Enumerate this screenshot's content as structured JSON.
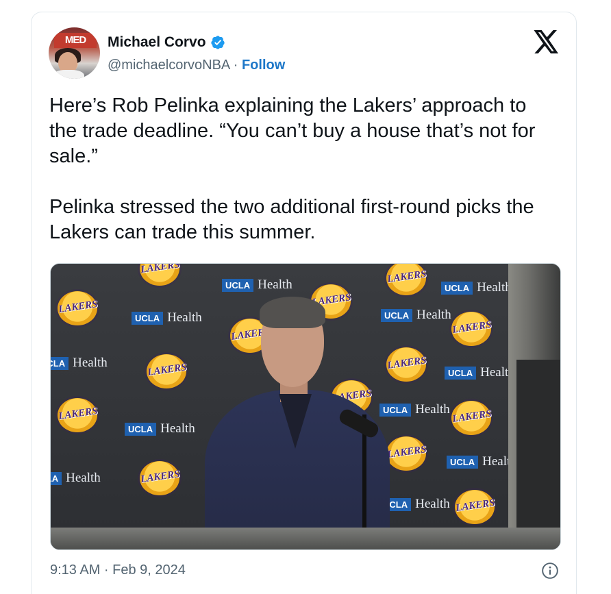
{
  "author": {
    "display_name": "Michael Corvo",
    "handle": "@michaelcorvoNBA",
    "separator": "·",
    "follow_label": "Follow",
    "avatar_sign_text": "MED"
  },
  "tweet": {
    "paragraphs": [
      "Here’s Rob Pelinka explaining the Lakers’ approach to the trade deadline. “You can’t buy a house that’s not for sale.”",
      "Pelinka stressed the two additional first-round picks the Lakers can trade this summer."
    ],
    "timestamp": "9:13 AM · Feb 9, 2024"
  },
  "media": {
    "backdrop_ucla_text": "UCLA",
    "backdrop_health_text": "Health"
  },
  "icons": {
    "verified": "verified-badge-icon",
    "brand": "x-logo-icon",
    "info": "info-icon"
  },
  "colors": {
    "verified_blue": "#1d9bf0",
    "follow_blue": "#1d77c8",
    "text_primary": "#0f1419",
    "text_secondary": "#536471"
  }
}
